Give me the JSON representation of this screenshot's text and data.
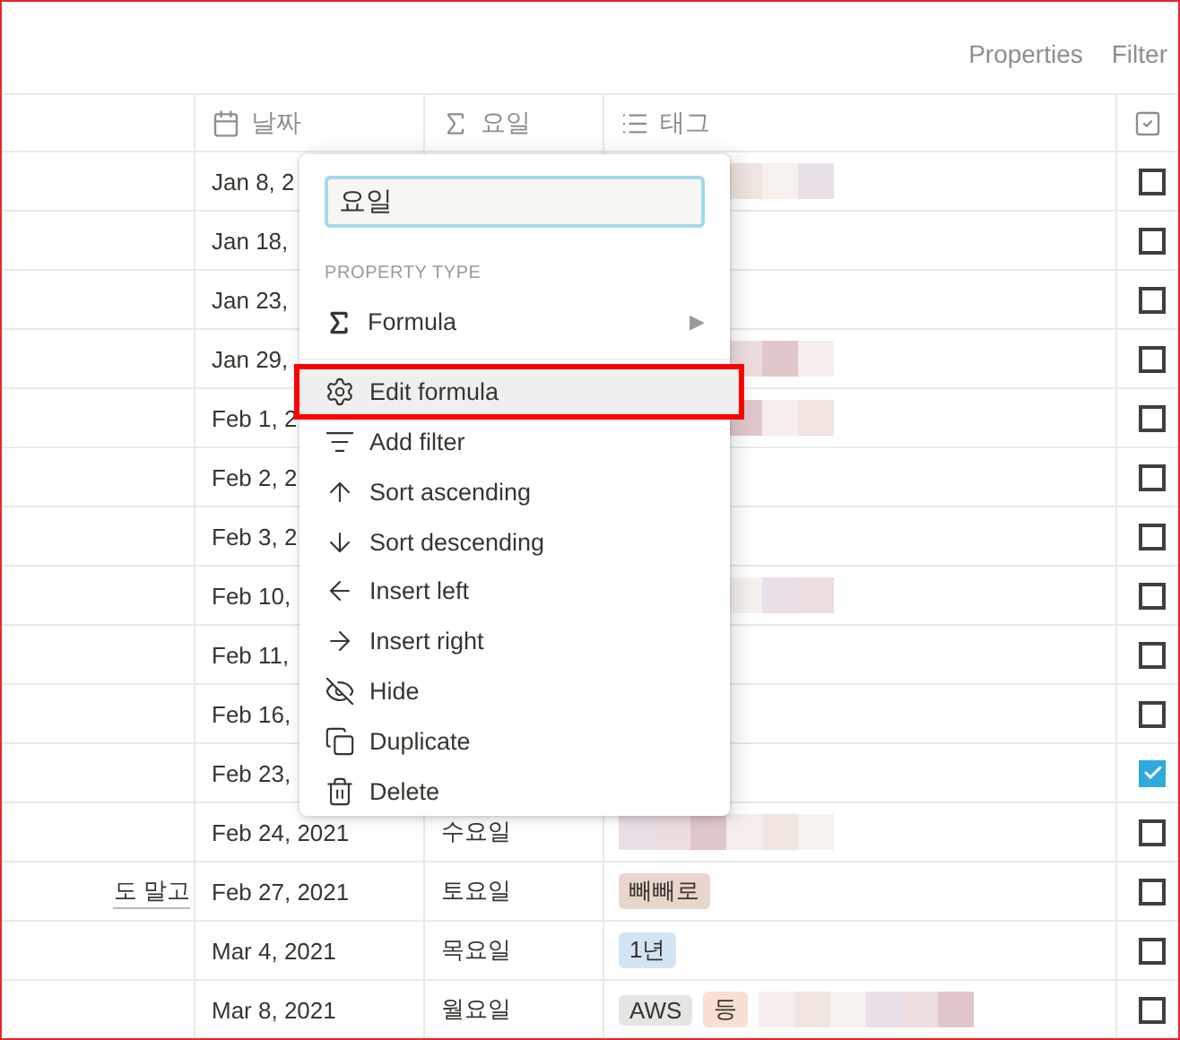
{
  "toolbar": {
    "links": [
      "Properties",
      "Filter"
    ]
  },
  "table": {
    "columns": [
      {
        "label": "날짜"
      },
      {
        "label": "요일"
      },
      {
        "label": "태그"
      },
      {}
    ],
    "rows": [
      {
        "date": "Jan 8, 2",
        "redacted": true,
        "checked": false
      },
      {
        "date": "Jan 18,",
        "redacted": false,
        "checked": false
      },
      {
        "date": "Jan 23,",
        "redacted": false,
        "checked": false
      },
      {
        "date": "Jan 29,",
        "redacted": true,
        "checked": false
      },
      {
        "date": "Feb 1, 2",
        "redacted": true,
        "checked": false
      },
      {
        "date": "Feb 2, 2",
        "redacted": false,
        "checked": false
      },
      {
        "date": "Feb 3, 2",
        "redacted": false,
        "checked": false
      },
      {
        "date": "Feb 10,",
        "redacted": true,
        "checked": false
      },
      {
        "date": "Feb 11,",
        "redacted": false,
        "checked": false
      },
      {
        "date": "Feb 16,",
        "redacted": false,
        "checked": false
      },
      {
        "date": "Feb 23,",
        "redacted": false,
        "checked": true
      },
      {
        "date": "Feb 24, 2021",
        "weekday": "수요일",
        "redacted": true,
        "checked": false
      },
      {
        "name": "도 말고",
        "date": "Feb 27, 2021",
        "weekday": "토요일",
        "tags": [
          {
            "label": "빼빼로",
            "color": "#e8d5cc"
          }
        ],
        "redacted": false,
        "checked": false
      },
      {
        "date": "Mar 4, 2021",
        "weekday": "목요일",
        "tags": [
          {
            "label": "1년",
            "color": "#d3e5f4"
          }
        ],
        "redacted": false,
        "checked": false
      },
      {
        "date": "Mar 8, 2021",
        "weekday": "월요일",
        "tags": [
          {
            "label": "AWS",
            "color": "#e5e5e3"
          },
          {
            "label": "등",
            "color": "#f9e0d2"
          }
        ],
        "redacted": true,
        "checked": false
      }
    ]
  },
  "menu": {
    "name_value": "요일",
    "section_label": "PROPERTY TYPE",
    "type": {
      "label": "Formula",
      "arrow": "▶"
    },
    "items": [
      {
        "label": "Edit formula",
        "highlighted": true
      },
      {
        "label": "Add filter",
        "highlighted": false
      },
      {
        "label": "Sort ascending",
        "highlighted": false
      },
      {
        "label": "Sort descending",
        "highlighted": false
      },
      {
        "label": "Insert left",
        "highlighted": false
      },
      {
        "label": "Insert right",
        "highlighted": false
      },
      {
        "label": "Hide",
        "highlighted": false
      },
      {
        "label": "Duplicate",
        "highlighted": false
      },
      {
        "label": "Delete",
        "highlighted": false
      }
    ]
  }
}
